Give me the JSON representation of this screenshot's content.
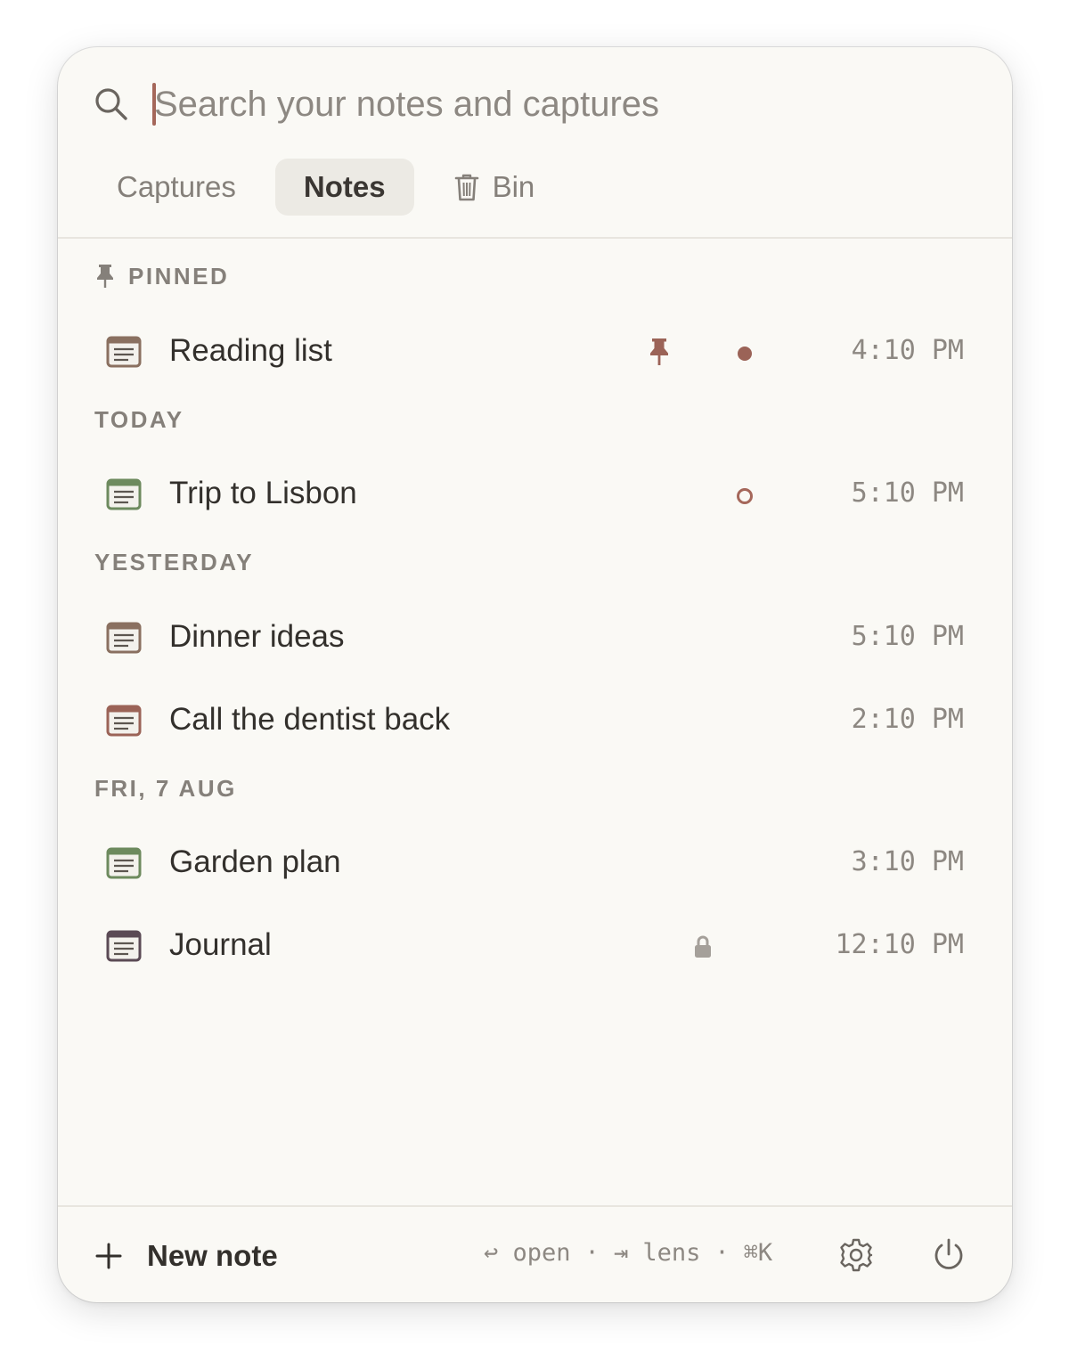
{
  "search": {
    "placeholder": "Search your notes and captures",
    "value": ""
  },
  "tabs": [
    {
      "label": "Captures",
      "active": false
    },
    {
      "label": "Notes",
      "active": true
    },
    {
      "label": "Bin",
      "active": false,
      "icon": "trash-icon"
    }
  ],
  "sections": [
    {
      "header": "PINNED",
      "header_icon": "pin-icon",
      "items": [
        {
          "title": "Reading list",
          "time": "4:10 PM",
          "icon_accent": "#8a7060",
          "pinned": true,
          "status": "filled-dot"
        }
      ]
    },
    {
      "header": "TODAY",
      "items": [
        {
          "title": "Trip to Lisbon",
          "time": "5:10 PM",
          "icon_accent": "#6d8a5e",
          "status": "hollow-dot"
        }
      ]
    },
    {
      "header": "YESTERDAY",
      "items": [
        {
          "title": "Dinner ideas",
          "time": "5:10 PM",
          "icon_accent": "#8a7060"
        },
        {
          "title": "Call the dentist back",
          "time": "2:10 PM",
          "icon_accent": "#9b6357"
        }
      ]
    },
    {
      "header": "FRI, 7 AUG",
      "items": [
        {
          "title": "Garden plan",
          "time": "3:10 PM",
          "icon_accent": "#6d8a5e"
        },
        {
          "title": "Journal",
          "time": "12:10 PM",
          "icon_accent": "#5b4a55",
          "locked": true
        }
      ]
    }
  ],
  "footer": {
    "new_note_label": "New note",
    "hint_open": "↩ open",
    "hint_sep": "·",
    "hint_lens": "⇥ lens",
    "hint_shortcut": "⌘K"
  },
  "colors": {
    "accent": "#a5675a",
    "background": "#faf9f5",
    "text": "#33302c",
    "muted": "#85807a"
  }
}
